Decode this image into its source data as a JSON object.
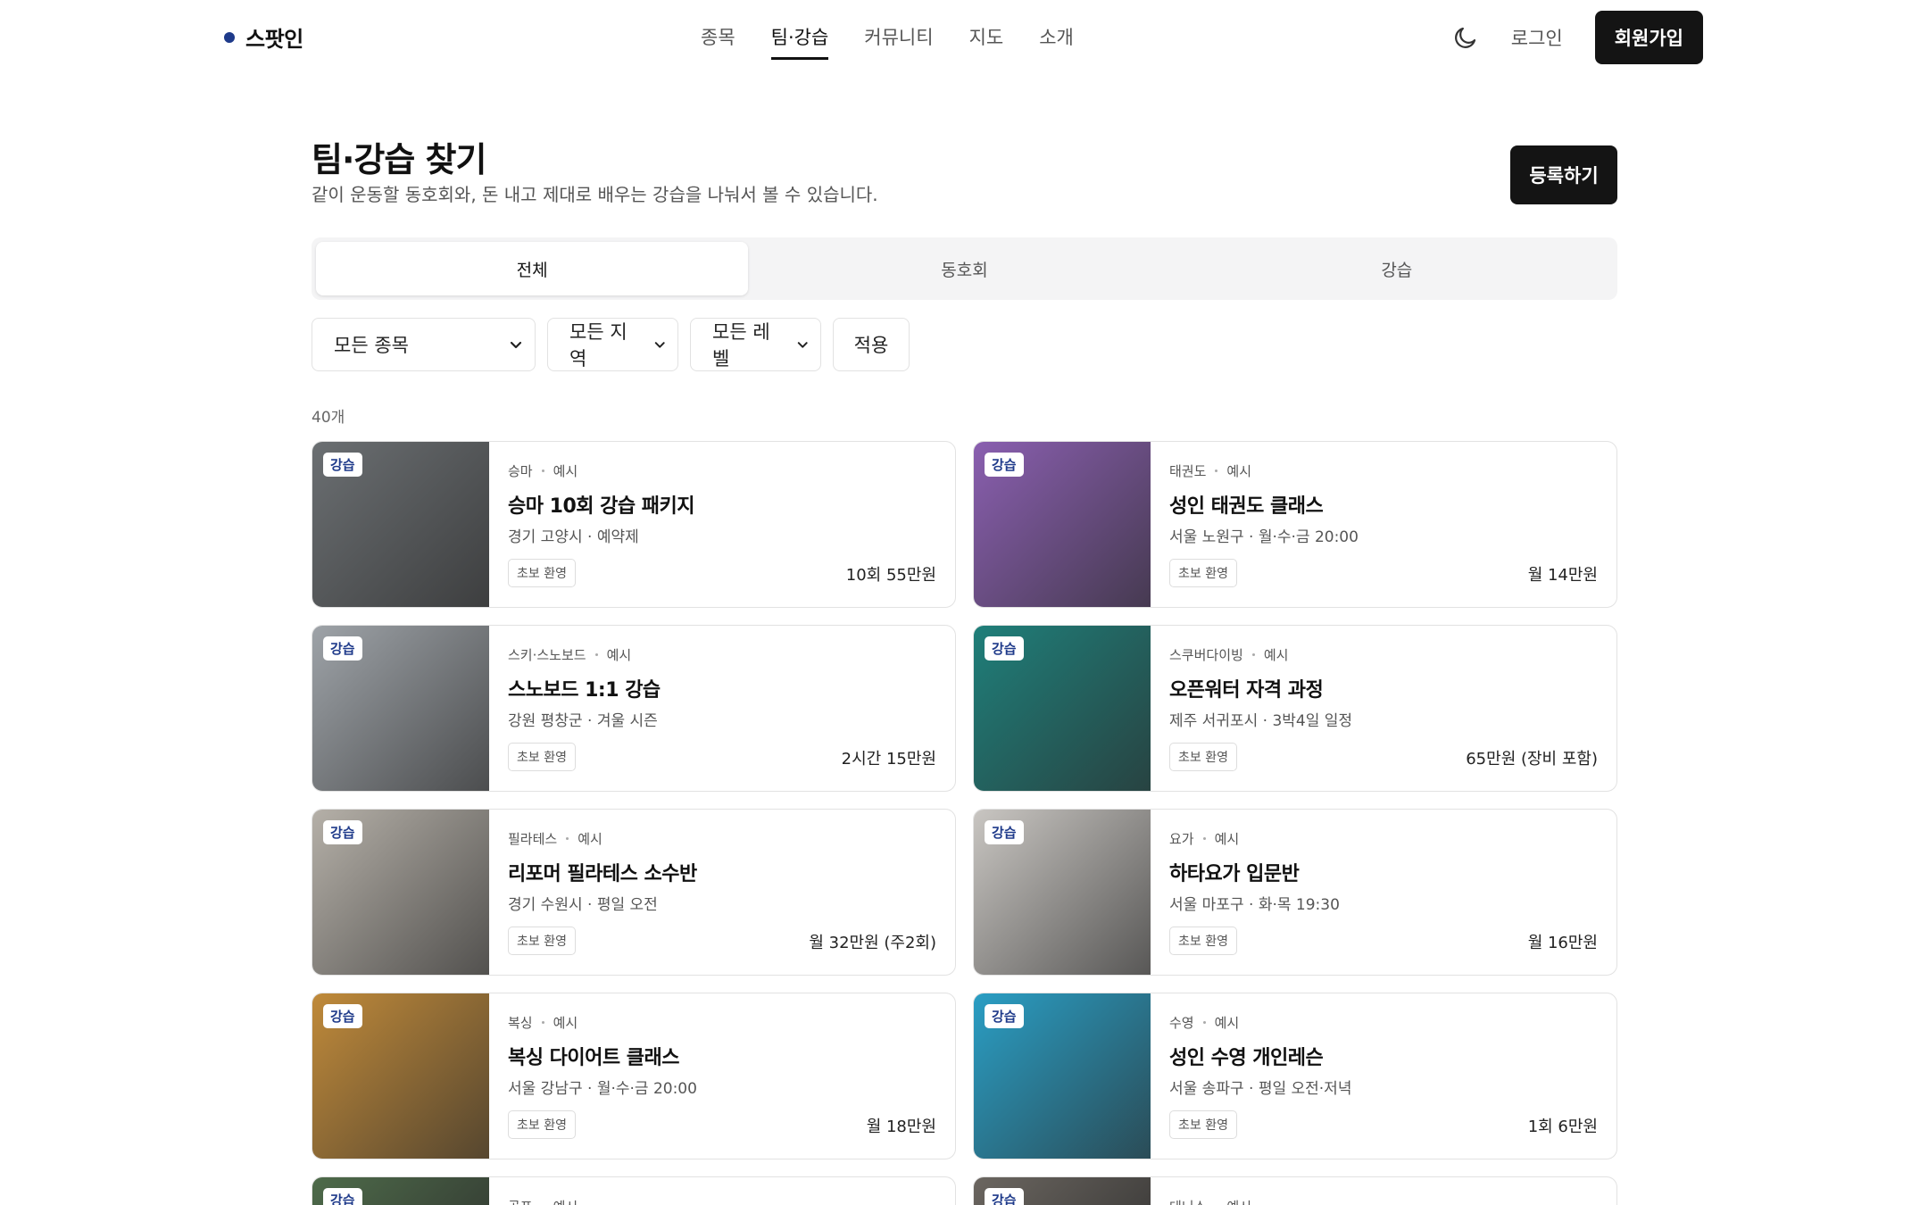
{
  "header": {
    "logo_text": "스팟인",
    "nav": [
      "종목",
      "팀·강습",
      "커뮤니티",
      "지도",
      "소개"
    ],
    "login": "로그인",
    "signup": "회원가입"
  },
  "page": {
    "title": "팀·강습 찾기",
    "subtitle": "같이 운동할 동호회와, 돈 내고 제대로 배우는 강습을 나눠서 볼 수 있습니다.",
    "register": "등록하기"
  },
  "tabs": [
    "전체",
    "동호회",
    "강습"
  ],
  "filters": {
    "sport": "모든 종목",
    "region": "모든 지역",
    "level": "모든 레벨",
    "apply": "적용"
  },
  "count": "40개",
  "cards": [
    {
      "badge": "강습",
      "sport": "승마",
      "sample": "예시",
      "title": "승마 10회 강습 패키지",
      "location": "경기 고양시 · 예약제",
      "tag": "초보 환영",
      "price": "10회 55만원",
      "thumb": "#6b6f72"
    },
    {
      "badge": "강습",
      "sport": "태권도",
      "sample": "예시",
      "title": "성인 태권도 클래스",
      "location": "서울 노원구 · 월·수·금 20:00",
      "tag": "초보 환영",
      "price": "월 14만원",
      "thumb": "#8a5fb0"
    },
    {
      "badge": "강습",
      "sport": "스키·스노보드",
      "sample": "예시",
      "title": "스노보드 1:1 강습",
      "location": "강원 평창군 · 겨울 시즌",
      "tag": "초보 환영",
      "price": "2시간 15만원",
      "thumb": "#9ea3a8"
    },
    {
      "badge": "강습",
      "sport": "스쿠버다이빙",
      "sample": "예시",
      "title": "오픈워터 자격 과정",
      "location": "제주 서귀포시 · 3박4일 일정",
      "tag": "초보 환영",
      "price": "65만원 (장비 포함)",
      "thumb": "#1f7f7a"
    },
    {
      "badge": "강습",
      "sport": "필라테스",
      "sample": "예시",
      "title": "리포머 필라테스 소수반",
      "location": "경기 수원시 · 평일 오전",
      "tag": "초보 환영",
      "price": "월 32만원 (주2회)",
      "thumb": "#b5b0a8"
    },
    {
      "badge": "강습",
      "sport": "요가",
      "sample": "예시",
      "title": "하타요가 입문반",
      "location": "서울 마포구 · 화·목 19:30",
      "tag": "초보 환영",
      "price": "월 16만원",
      "thumb": "#c9c6c2"
    },
    {
      "badge": "강습",
      "sport": "복싱",
      "sample": "예시",
      "title": "복싱 다이어트 클래스",
      "location": "서울 강남구 · 월·수·금 20:00",
      "tag": "초보 환영",
      "price": "월 18만원",
      "thumb": "#c08a3a"
    },
    {
      "badge": "강습",
      "sport": "수영",
      "sample": "예시",
      "title": "성인 수영 개인레슨",
      "location": "서울 송파구 · 평일 오전·저녁",
      "tag": "초보 환영",
      "price": "1회 6만원",
      "thumb": "#2a9ec4"
    },
    {
      "badge": "강습",
      "sport": "골프",
      "sample": "예시",
      "thumb": "#4e6b4a"
    },
    {
      "badge": "강습",
      "sport": "테니스",
      "sample": "예시",
      "thumb": "#6b6660"
    }
  ]
}
